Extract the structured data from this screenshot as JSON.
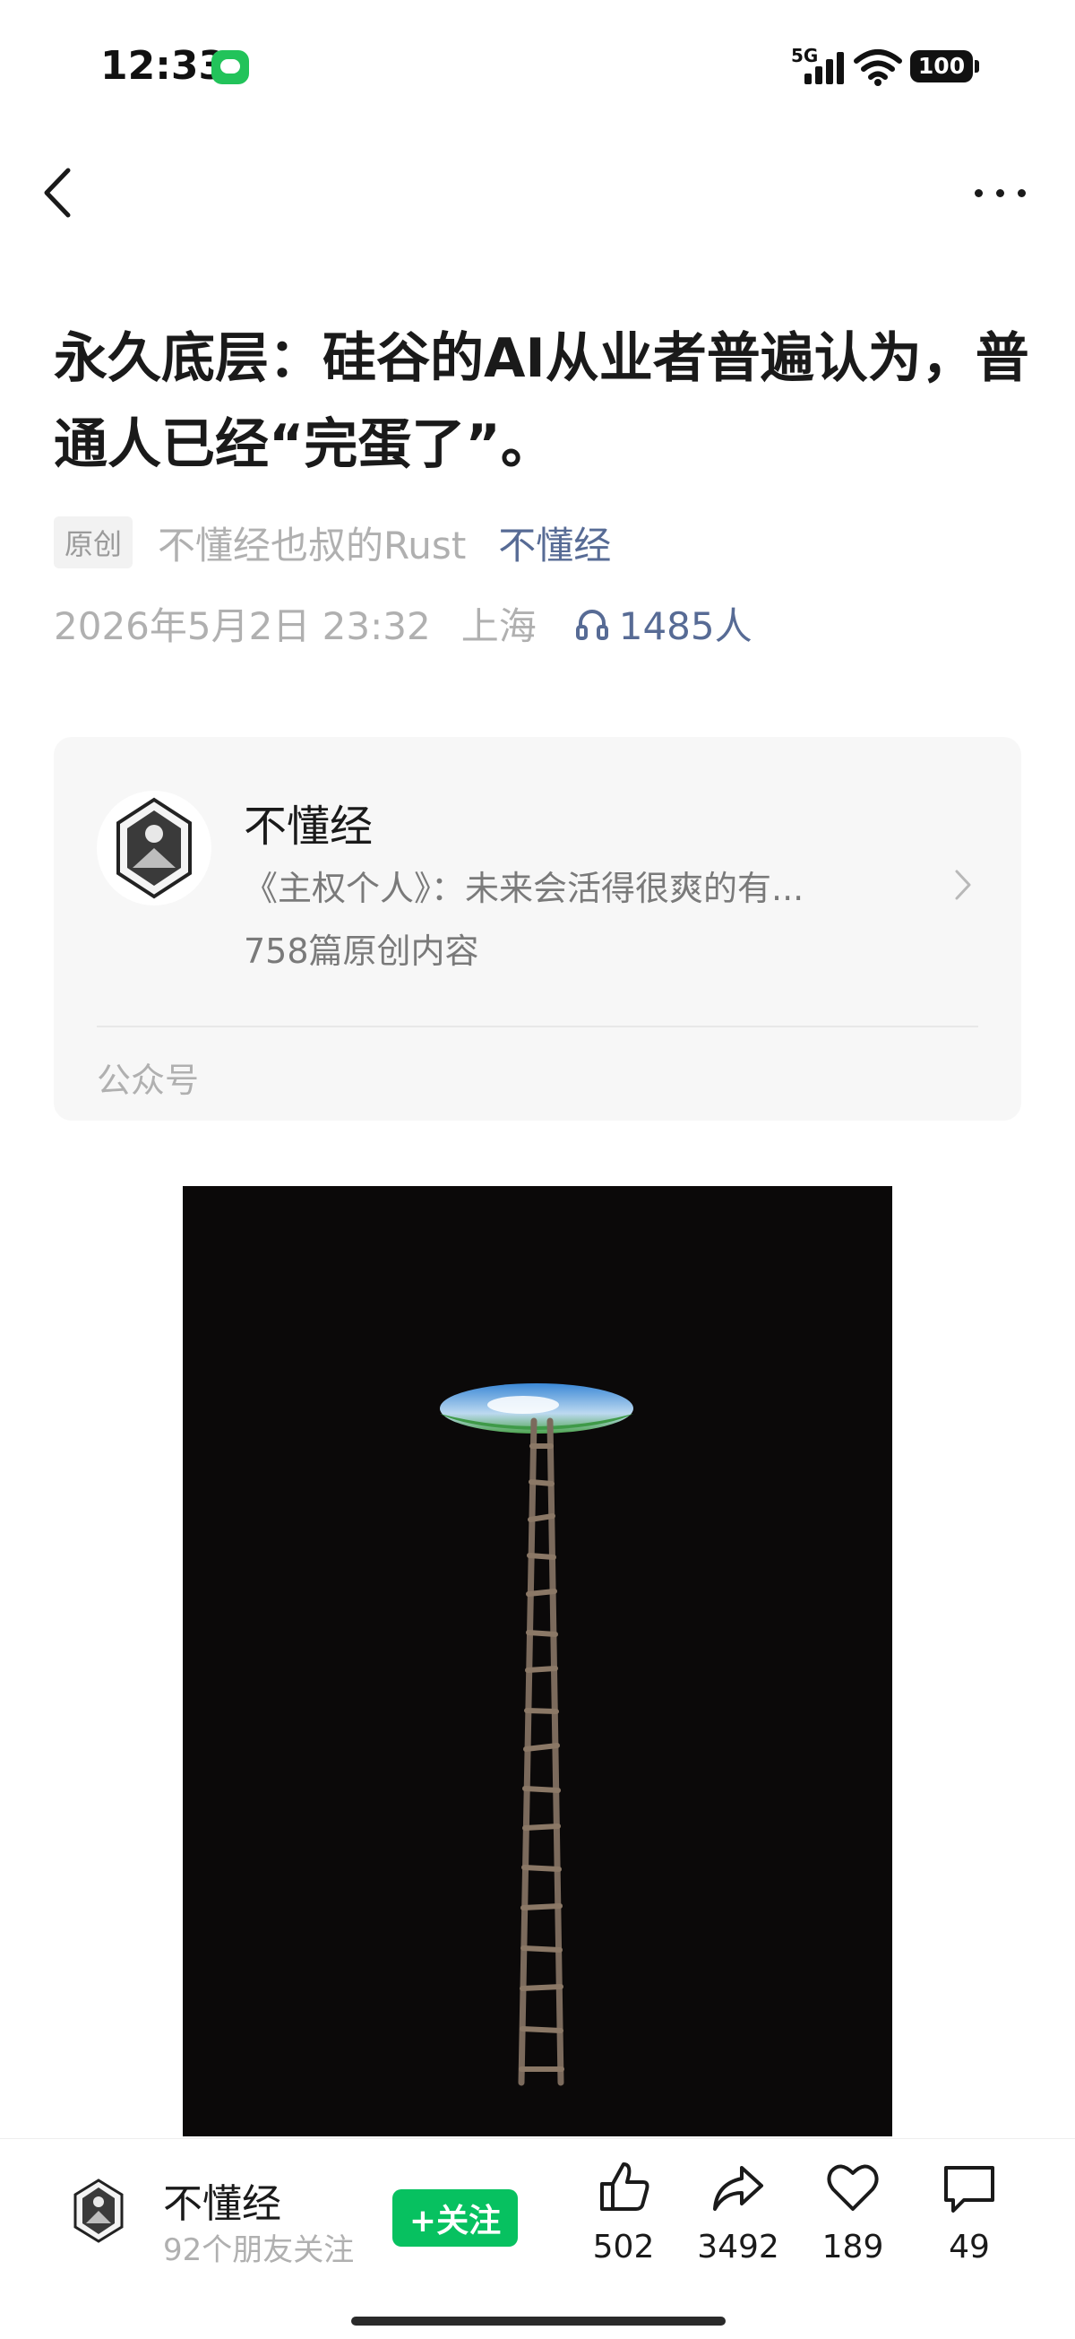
{
  "status_bar": {
    "time": "12:33",
    "network": "5G",
    "battery": "100"
  },
  "article": {
    "title": "永久底层：硅谷的AI从业者普遍认为，普通人已经“完蛋了”。",
    "original_badge": "原创",
    "author": "不懂经也叔的Rust",
    "account": "不懂经",
    "date": "2026年5月2日 23:32",
    "location": "上海",
    "listeners": "1485人"
  },
  "account_card": {
    "name": "不懂经",
    "description": "《主权个人》：未来会活得很爽的有...",
    "article_count": "758篇原创内容",
    "type": "公众号"
  },
  "bottom_bar": {
    "name": "不懂经",
    "friends_following": "92个朋友关注",
    "follow_label": "+关注",
    "likes": "502",
    "shares": "3492",
    "favorites": "189",
    "comments": "49"
  },
  "colors": {
    "accent_green": "#07c160",
    "link_blue": "#576b95",
    "text_gray": "#b0b0b0"
  }
}
